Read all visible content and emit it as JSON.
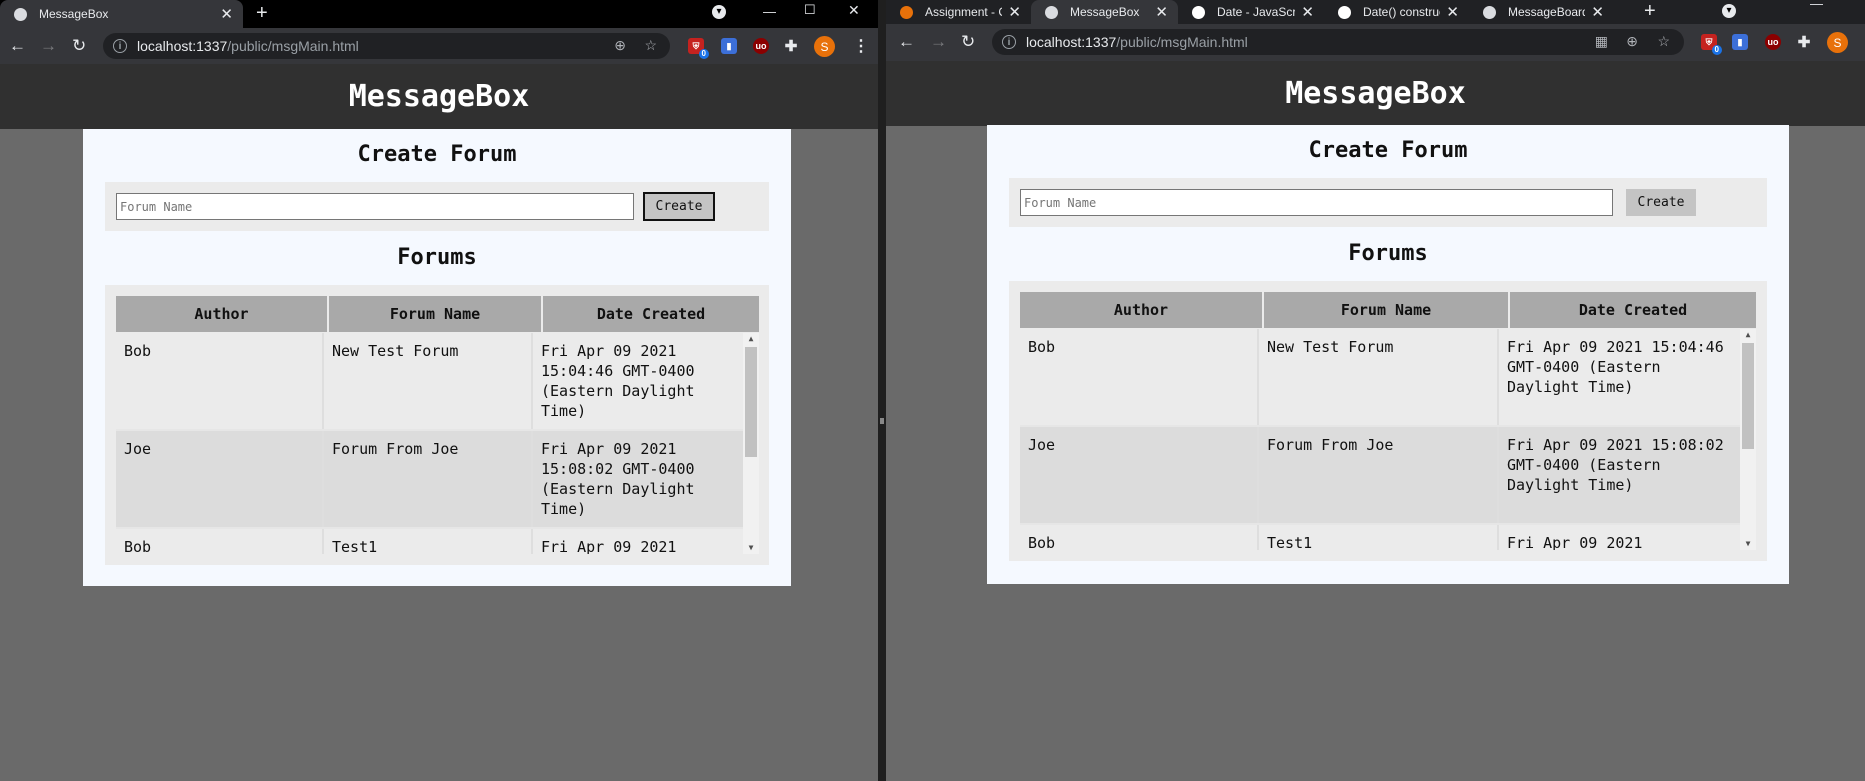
{
  "windows": [
    {
      "id": "left",
      "tabs": [
        {
          "title": "MessageBox",
          "active": true,
          "favicon_color": "#dadce0"
        }
      ],
      "url_host": "localhost:1337",
      "url_path": "/public/msgMain.html"
    },
    {
      "id": "right",
      "tabs": [
        {
          "title": "Assignment - C",
          "active": false,
          "favicon_color": "#e8710a"
        },
        {
          "title": "MessageBox",
          "active": true,
          "favicon_color": "#dadce0"
        },
        {
          "title": "Date - JavaScrip",
          "active": false,
          "favicon_color": "#ffffff"
        },
        {
          "title": "Date() construc",
          "active": false,
          "favicon_color": "#ffffff"
        },
        {
          "title": "MessageBoard",
          "active": false,
          "favicon_color": "#dadce0"
        }
      ],
      "url_host": "localhost:1337",
      "url_path": "/public/msgMain.html"
    }
  ],
  "extensions": [
    {
      "name": "ublock-red-icon",
      "color": "#c5221f",
      "badge": "0"
    },
    {
      "name": "notes-blue-icon",
      "color": "#3c6fd8",
      "badge": ""
    },
    {
      "name": "ublock-origin-icon",
      "color": "#8b0000",
      "badge": ""
    },
    {
      "name": "extensions-puzzle-icon",
      "color": "",
      "badge": ""
    }
  ],
  "profile_initial": "S",
  "app": {
    "title": "MessageBox",
    "create_heading": "Create Forum",
    "forum_name_placeholder": "Forum Name",
    "create_button": "Create",
    "forums_heading": "Forums",
    "columns": [
      "Author",
      "Forum Name",
      "Date Created"
    ],
    "rows": [
      {
        "author": "Bob",
        "name": "New Test Forum",
        "date": "Fri Apr 09 2021 15:04:46 GMT-0400 (Eastern Daylight Time)"
      },
      {
        "author": "Joe",
        "name": "Forum From Joe",
        "date": "Fri Apr 09 2021 15:08:02 GMT-0400 (Eastern Daylight Time)"
      },
      {
        "author": "Bob",
        "name": "Test1",
        "date": "Fri Apr 09 2021"
      }
    ]
  },
  "colors": {
    "header_bg": "#303030",
    "page_bg": "#6a6a6a",
    "card_bg": "#f5f9ff",
    "th_bg": "#a9a9a9"
  }
}
